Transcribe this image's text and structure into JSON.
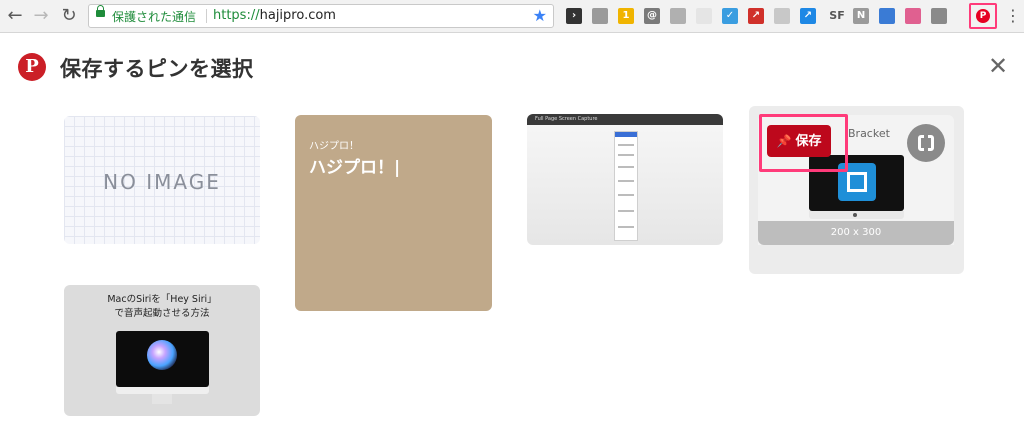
{
  "browser": {
    "security_label": "保護された通信",
    "url_scheme": "https://",
    "url_host": "hajipro.com",
    "extensions": [
      {
        "name": "dark-ext",
        "color": "#333333",
        "glyph": "›"
      },
      {
        "name": "shelf-ext",
        "color": "#9a9a9a",
        "glyph": ""
      },
      {
        "name": "badge-ext",
        "color": "#f0b400",
        "glyph": "1"
      },
      {
        "name": "at-ext",
        "color": "#7a7a7a",
        "glyph": "@"
      },
      {
        "name": "puzzle-ext",
        "color": "#b0b0b0",
        "glyph": ""
      },
      {
        "name": "blank-ext",
        "color": "#e5e5e5",
        "glyph": ""
      },
      {
        "name": "check-ext",
        "color": "#3a9de0",
        "glyph": "✓"
      },
      {
        "name": "arrow-ext",
        "color": "#d0302a",
        "glyph": "↗"
      },
      {
        "name": "chat-ext",
        "color": "#c8c8c8",
        "glyph": ""
      },
      {
        "name": "share-ext",
        "color": "#1e88e5",
        "glyph": "↗"
      },
      {
        "name": "sf-ext",
        "text": "SF"
      },
      {
        "name": "n-ext",
        "color": "#9a9a9a",
        "glyph": "N"
      },
      {
        "name": "tag-ext",
        "color": "#3a7bd5",
        "glyph": ""
      },
      {
        "name": "pen-ext",
        "color": "#e06090",
        "glyph": ""
      },
      {
        "name": "camera-ext",
        "color": "#8a8a8a",
        "glyph": ""
      }
    ]
  },
  "modal": {
    "title": "保存するピンを選択"
  },
  "cards": {
    "no_image": {
      "label": "NO IMAGE"
    },
    "hajipro": {
      "small": "ハジプロ！",
      "big": "ハジプロ！|"
    },
    "screen_capture": {
      "bar_title": "Full Page Screen Capture"
    },
    "bracket": {
      "label": "Bracket",
      "dimensions": "200 x 300",
      "save_label": "保存"
    },
    "siri": {
      "title": "MacのSiriを「Hey Siri」\nで音声起動させる方法"
    }
  },
  "colors": {
    "pinterest_red": "#bd081c",
    "highlight": "#ff3b7a",
    "tan_card": "#c0a98a"
  }
}
